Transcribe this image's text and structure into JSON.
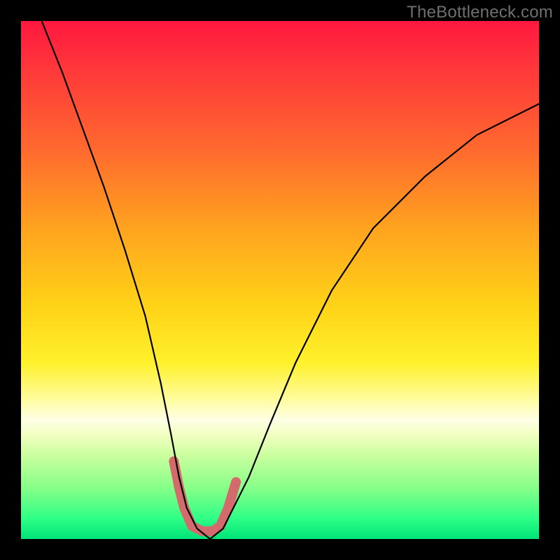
{
  "watermark": "TheBottleneck.com",
  "chart_data": {
    "type": "line",
    "title": "",
    "xlabel": "",
    "ylabel": "",
    "xlim": [
      0,
      100
    ],
    "ylim": [
      0,
      100
    ],
    "series": [
      {
        "name": "curve",
        "x": [
          0,
          4,
          8,
          12,
          16,
          20,
          24,
          27,
          29,
          30.5,
          32,
          34,
          36.5,
          39,
          41,
          44,
          48,
          53,
          60,
          68,
          78,
          88,
          100
        ],
        "values": [
          110,
          100,
          90,
          79,
          68,
          56,
          43,
          30,
          20,
          12,
          6,
          2,
          0,
          2,
          6,
          12,
          22,
          34,
          48,
          60,
          70,
          78,
          84
        ],
        "color": "#000000",
        "width": 2.2
      },
      {
        "name": "highlight",
        "x": [
          29.5,
          30.5,
          31.5,
          33,
          35,
          37,
          38.5,
          40,
          41.5
        ],
        "values": [
          15,
          10,
          6,
          2.5,
          1.5,
          1.5,
          2.5,
          6,
          11
        ],
        "color": "#d36a6c",
        "width": 14
      }
    ],
    "gradient_stops": [
      {
        "pct": 0,
        "color": "#ff173f"
      },
      {
        "pct": 10,
        "color": "#ff3a3a"
      },
      {
        "pct": 25,
        "color": "#ff6a2e"
      },
      {
        "pct": 40,
        "color": "#ffa31f"
      },
      {
        "pct": 55,
        "color": "#ffd317"
      },
      {
        "pct": 66,
        "color": "#fff12b"
      },
      {
        "pct": 73,
        "color": "#fffc9e"
      },
      {
        "pct": 77,
        "color": "#ffffe6"
      },
      {
        "pct": 80,
        "color": "#f1ffc0"
      },
      {
        "pct": 84,
        "color": "#c9ff9e"
      },
      {
        "pct": 90,
        "color": "#88ff88"
      },
      {
        "pct": 96,
        "color": "#2fff86"
      },
      {
        "pct": 100,
        "color": "#00e47a"
      }
    ]
  }
}
